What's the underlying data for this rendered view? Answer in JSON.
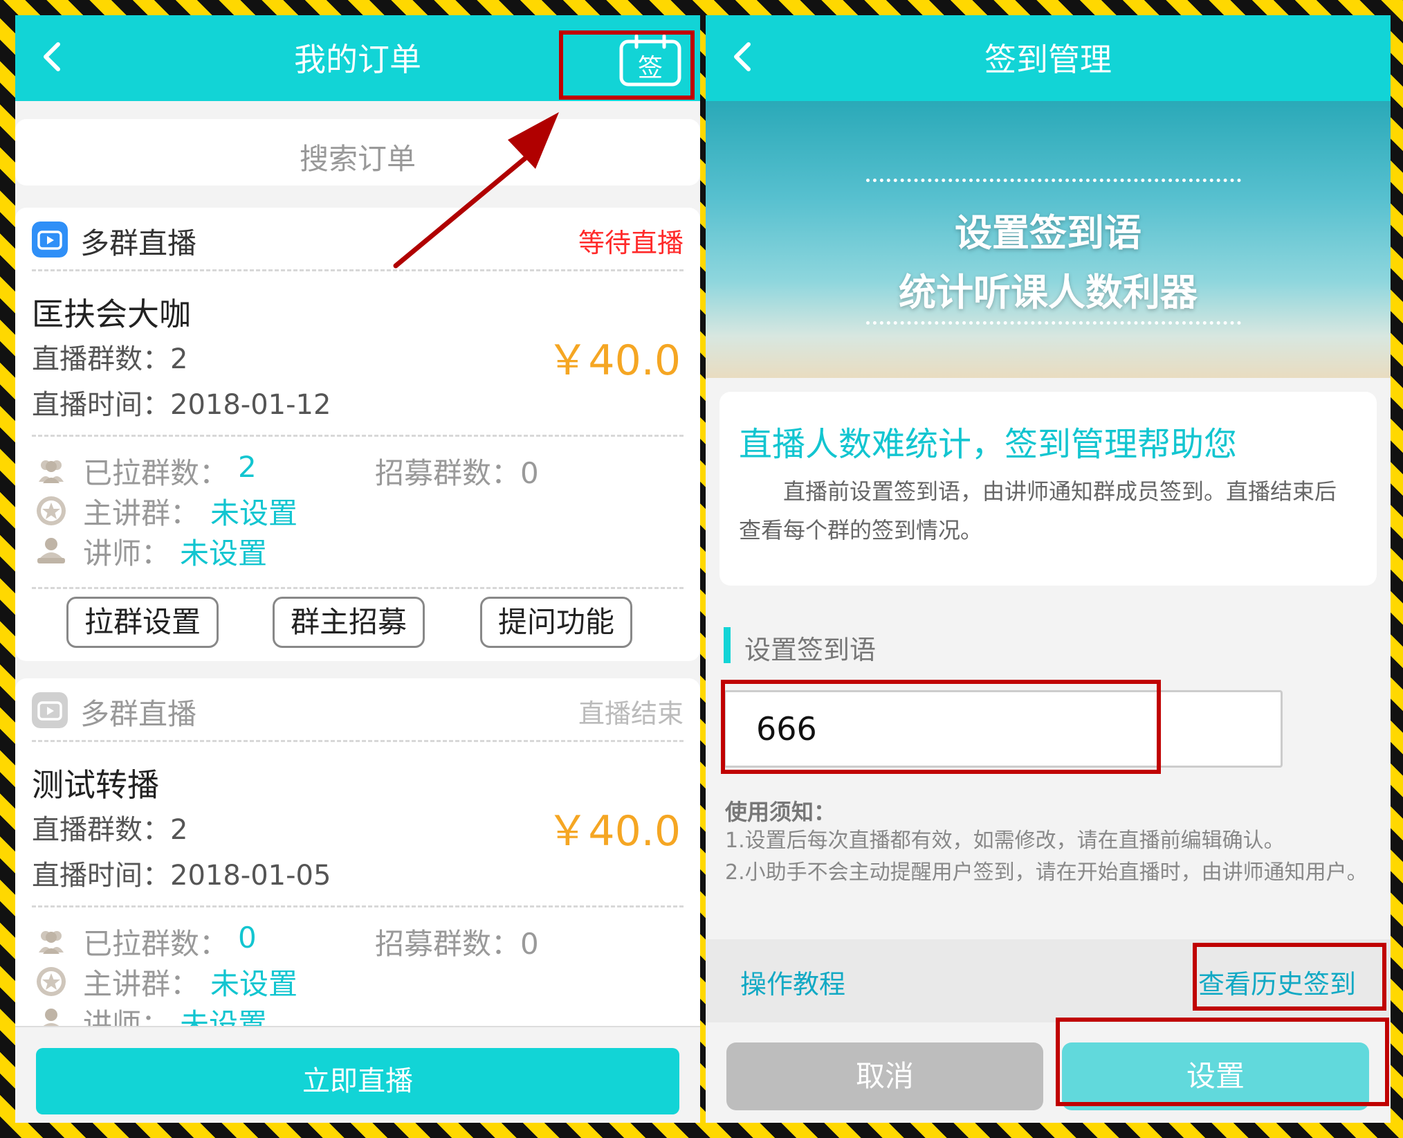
{
  "colors": {
    "accent": "#12d4d6",
    "link": "#12c5d0",
    "price": "#f5a623",
    "status_waiting": "#ff2a2a",
    "status_ended": "#bbbbbb",
    "annotation_red": "#c00000"
  },
  "left": {
    "header": {
      "title": "我的订单",
      "sign_icon_text": "签"
    },
    "search": {
      "placeholder": "搜索订单"
    },
    "orders": [
      {
        "type": "多群直播",
        "status": "等待直播",
        "title": "匡扶会大咖",
        "group_count_line": "直播群数：2",
        "time_line": "直播时间：2018-01-12",
        "price": "￥40.0",
        "pulled_label": "已拉群数：",
        "pulled_value": "2",
        "recruit_line": "招募群数：0",
        "main_group_label": "主讲群：",
        "main_group_value": "未设置",
        "lecturer_label": "讲师：",
        "lecturer_value": "未设置",
        "buttons": [
          "拉群设置",
          "群主招募",
          "提问功能"
        ]
      },
      {
        "type": "多群直播",
        "status": "直播结束",
        "title": "测试转播",
        "group_count_line": "直播群数：2",
        "time_line": "直播时间：2018-01-05",
        "price": "￥40.0",
        "pulled_label": "已拉群数：",
        "pulled_value": "0",
        "recruit_line": "招募群数：0",
        "main_group_label": "主讲群：",
        "main_group_value": "未设置",
        "lecturer_label": "讲师：",
        "lecturer_value": "未设置"
      }
    ],
    "go_live_button": "立即直播"
  },
  "right": {
    "header": {
      "title": "签到管理"
    },
    "banner": {
      "line1": "设置签到语",
      "line2": "统计听课人数利器"
    },
    "info": {
      "heading": "直播人数难统计，签到管理帮助您",
      "body": "直播前设置签到语，由讲师通知群成员签到。直播结束后查看每个群的签到情况。"
    },
    "section_label": "设置签到语",
    "input_value": "666",
    "notice": {
      "title": "使用须知：",
      "line1": "1.设置后每次直播都有效，如需修改，请在直播前编辑确认。",
      "line2": "2.小助手不会主动提醒用户签到，请在开始直播时，由讲师通知用户。"
    },
    "links": {
      "tutorial": "操作教程",
      "history": "查看历史签到"
    },
    "buttons": {
      "cancel": "取消",
      "confirm": "设置"
    }
  }
}
